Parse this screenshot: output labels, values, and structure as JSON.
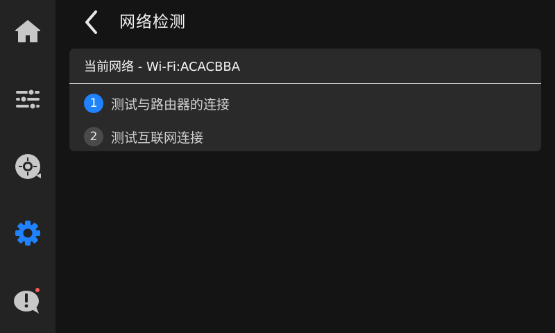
{
  "sidebar": {
    "items": [
      {
        "id": "home",
        "icon": "home-icon",
        "active": false
      },
      {
        "id": "adjust",
        "icon": "sliders-icon",
        "active": false
      },
      {
        "id": "camera",
        "icon": "camera-lens-icon",
        "active": false
      },
      {
        "id": "settings",
        "icon": "gear-icon",
        "active": true
      },
      {
        "id": "feedback",
        "icon": "alert-bubble-icon",
        "active": false,
        "has_notification": true
      }
    ],
    "active_color": "#1f82ff",
    "icon_color": "#c8c8c8",
    "notification_color": "#ff5a5a"
  },
  "header": {
    "back_icon": "chevron-left-icon",
    "title": "网络检测"
  },
  "panel": {
    "current_network": "当前网络 - Wi-Fi:ACACBBA",
    "steps": [
      {
        "number": "1",
        "label": "测试与路由器的连接",
        "status": "active"
      },
      {
        "number": "2",
        "label": "测试互联网连接",
        "status": "pending"
      }
    ]
  }
}
